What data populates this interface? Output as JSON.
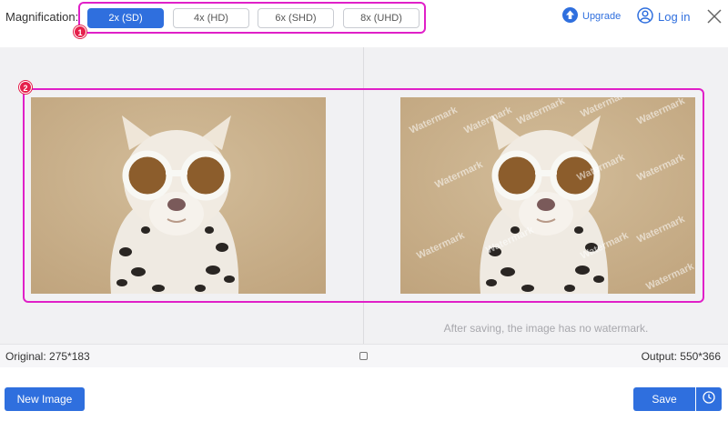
{
  "toolbar": {
    "magnification_label": "Magnification:",
    "options": [
      "2x (SD)",
      "4x (HD)",
      "6x (SHD)",
      "8x (UHD)"
    ],
    "selected": "2x (SD)",
    "upgrade_label": "Upgrade",
    "login_label": "Log in",
    "badge_1": "1"
  },
  "preview": {
    "badge_2": "2",
    "watermark_text": "Watermark",
    "note": "After saving, the image has no watermark."
  },
  "info": {
    "original": "Original: 275*183",
    "output": "Output: 550*366"
  },
  "actions": {
    "new_image": "New Image",
    "save": "Save"
  },
  "colors": {
    "accent": "#2f6fde",
    "highlight": "#e020c8",
    "badge": "#e5204b"
  },
  "icons": [
    "upgrade-arrow-icon",
    "user-icon",
    "close-icon",
    "compare-icon",
    "history-clock-icon"
  ]
}
